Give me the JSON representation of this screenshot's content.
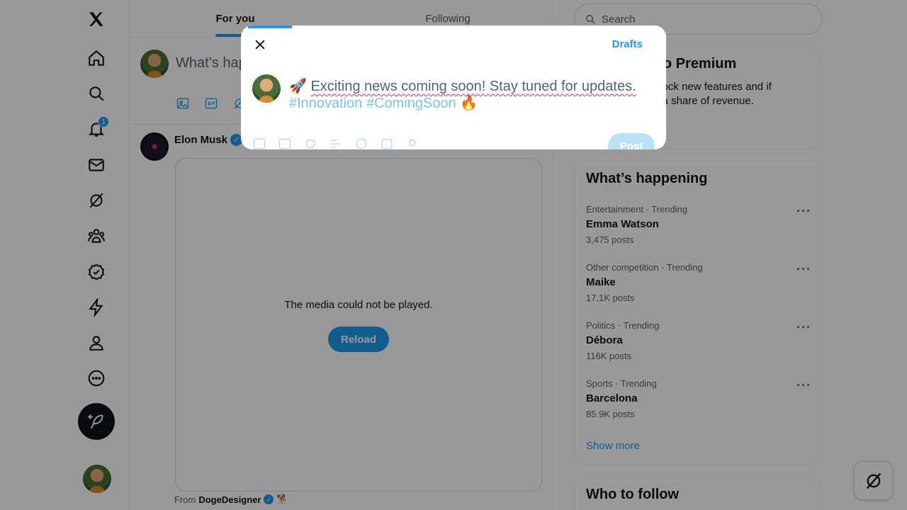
{
  "tabs": {
    "for_you": "For you",
    "following": "Following"
  },
  "composer": {
    "placeholder": "What’s happening?"
  },
  "nav": {
    "notifications_badge": "1"
  },
  "post": {
    "author": "Elon Musk",
    "media_message": "The media could not be played.",
    "reload_label": "Reload",
    "from_label": "From",
    "from_source": "DogeDesigner"
  },
  "search": {
    "placeholder": "Search"
  },
  "premium": {
    "title": "Subscribe to Premium",
    "body": "Subscribe to unlock new features and if eligible, receive a share of revenue."
  },
  "trending": {
    "title": "What’s happening",
    "items": [
      {
        "category": "Entertainment · Trending",
        "name": "Emma Watson",
        "count": "3,475 posts"
      },
      {
        "category": "Other competition · Trending",
        "name": "Maike",
        "count": "17.1K posts"
      },
      {
        "category": "Politics · Trending",
        "name": "Débora",
        "count": "116K posts"
      },
      {
        "category": "Sports · Trending",
        "name": "Barcelona",
        "count": "85.9K posts"
      }
    ],
    "show_more": "Show more"
  },
  "follow": {
    "title": "Who to follow"
  },
  "modal": {
    "drafts": "Drafts",
    "text_emoji_start": "🚀",
    "text_main": "Exciting news coming soon! Stay tuned for updates.",
    "hashtags": "#Innovation #ComingSoon",
    "text_emoji_end": "🔥",
    "post_label": "Post"
  }
}
